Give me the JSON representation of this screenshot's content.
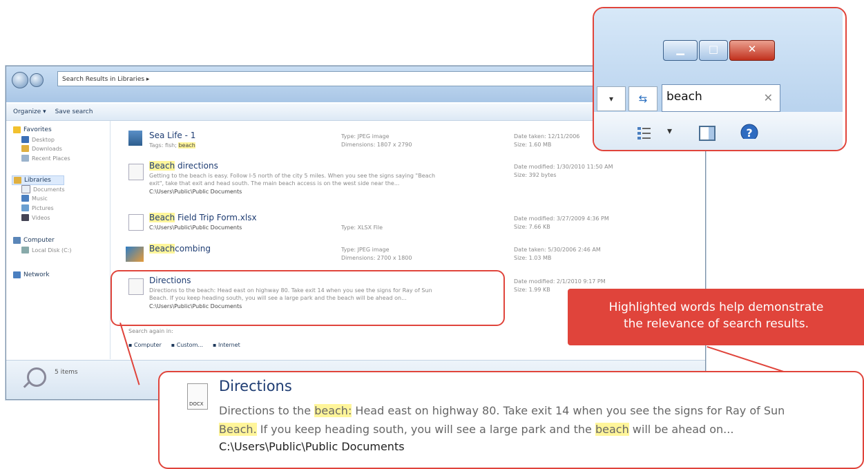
{
  "explorer": {
    "address": "Search Results in Libraries ▸",
    "toolbar": {
      "organize": "Organize ▾",
      "save_search": "Save search"
    },
    "nav": {
      "favorites": "Favorites",
      "desktop": "Desktop",
      "downloads": "Downloads",
      "recent": "Recent Places",
      "libraries": "Libraries",
      "documents": "Documents",
      "music": "Music",
      "pictures": "Pictures",
      "videos": "Videos",
      "computer": "Computer",
      "local_disk": "Local Disk (C:)",
      "network": "Network"
    },
    "results": [
      {
        "name_hl": "",
        "name_rest": "Sea Life - 1",
        "sub": "Tags: fish; ",
        "sub_hl": "beach",
        "mid1": "Type: JPEG image",
        "mid2": "Dimensions: 1807 x 2790",
        "rt1": "Date taken: 12/11/2006",
        "rt2": "Size: 1.60 MB"
      },
      {
        "name_hl": "Beach",
        "name_rest": " directions",
        "line1": "Getting to the beach is easy. Follow I-5 north of the city 5 miles. When you see the signs saying \"Beach",
        "line2": "exit\", take that exit and head south. The main beach access is on the west side near the...",
        "path": "C:\\Users\\Public\\Public Documents",
        "rt1": "Date modified: 1/30/2010 11:50 AM",
        "rt2": "Size: 392 bytes"
      },
      {
        "name_hl": "Beach",
        "name_rest": " Field Trip Form.xlsx",
        "path": "C:\\Users\\Public\\Public Documents",
        "mid": "Type: XLSX File",
        "rt1": "Date modified: 3/27/2009 4:36 PM",
        "rt2": "Size: 7.66 KB"
      },
      {
        "name_hl": "Beach",
        "name_rest": "combing",
        "mid1": "Type: JPEG image",
        "mid2": "Dimensions: 2700 x 1800",
        "rt1": "Date taken: 5/30/2006 2:46 AM",
        "rt2": "Size: 1.03 MB"
      },
      {
        "name_hl": "",
        "name_rest": "Directions",
        "line1": "Directions to the beach: Head east on highway 80. Take exit 14 when you see the signs for Ray of Sun",
        "line2": "Beach. If you keep heading south, you will see a large park and the beach will be ahead on...",
        "path": "C:\\Users\\Public\\Public Documents",
        "rt1": "Date modified: 2/1/2010 9:17 PM",
        "rt2": "Size: 1.99 KB"
      }
    ],
    "search_again": "Search again in:",
    "search_again_links": {
      "computer": "Computer",
      "custom": "Custom...",
      "internet": "Internet"
    },
    "status": "5 items"
  },
  "zoom_search": {
    "minimize": "▁",
    "restore": "□",
    "close": "✕",
    "dropdown": "▾",
    "refresh": "⇆",
    "query": "beach",
    "clear": "✕",
    "view_icon": "view-options-icon",
    "view_dropdown": "▾"
  },
  "callout": {
    "line1": "Highlighted words help demonstrate",
    "line2": "the relevance of search results."
  },
  "zoom_result": {
    "ext": "DOCX",
    "title": "Directions",
    "t1": "Directions to the ",
    "h1": "beach:",
    "t2": " Head east on highway 80. Take exit 14 when you see the signs for Ray of Sun",
    "h2": "Beach.",
    "t3": " If you keep heading south, you will see a large park and the ",
    "h3": "beach",
    "t4": " will be ahead on...",
    "path": "C:\\Users\\Public\\Public Documents"
  },
  "colors": {
    "accent": "#e0443b",
    "highlight": "#fff59a",
    "title_text": "#1e3c72"
  }
}
